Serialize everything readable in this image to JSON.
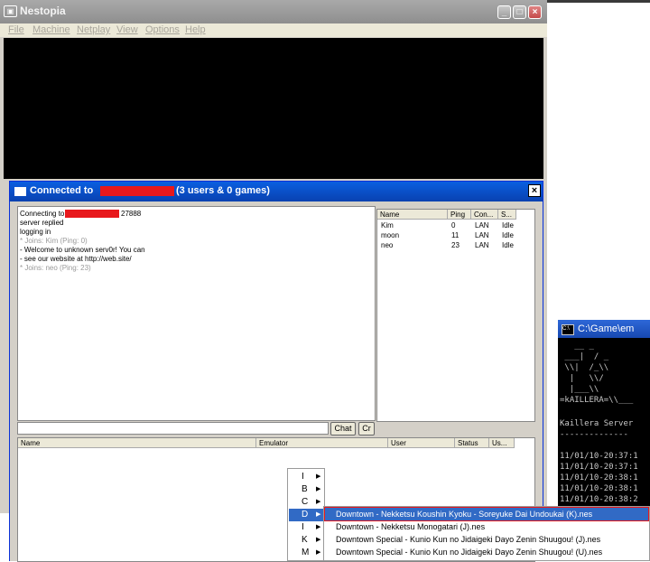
{
  "nestopia": {
    "title": "Nestopia",
    "menu": [
      "File",
      "Machine",
      "Netplay",
      "View",
      "Options",
      "Help"
    ]
  },
  "dialog": {
    "title_prefix": "Connected to",
    "title_suffix": "(3 users & 0 games)",
    "chat_lines": [
      {
        "text": "Connecting to",
        "style": "normal"
      },
      {
        "text": "27888",
        "style": "normal"
      },
      {
        "text": "server replied",
        "style": "normal"
      },
      {
        "text": "logging in",
        "style": "normal"
      },
      {
        "text": "* Joins: Kim (Ping: 0)",
        "style": "gray"
      },
      {
        "text": "- Welcome to unknown serv0r! You can",
        "style": "normal"
      },
      {
        "text": "- see our website at http://web.site/",
        "style": "normal"
      },
      {
        "text": "* Joins: neo (Ping: 23)",
        "style": "gray"
      }
    ],
    "user_columns": [
      "Name",
      "Ping",
      "Con...",
      "S..."
    ],
    "users": [
      {
        "name": "Kim",
        "ping": "0",
        "conn": "LAN",
        "status": "Idle"
      },
      {
        "name": "moon",
        "ping": "11",
        "conn": "LAN",
        "status": "Idle"
      },
      {
        "name": "neo",
        "ping": "23",
        "conn": "LAN",
        "status": "Idle"
      }
    ],
    "chat_button": "Chat",
    "create_button": "Cr",
    "game_columns": [
      "Name",
      "Emulator",
      "User",
      "Status",
      "Us..."
    ]
  },
  "context_menu": {
    "items": [
      "I",
      "B",
      "C",
      "D",
      "I",
      "K",
      "M"
    ],
    "selected_index": 3
  },
  "submenu": {
    "items": [
      "Downtown - Nekketsu Koushin Kyoku - Soreyuke Dai Undoukai (K).nes",
      "Downtown - Nekketsu Monogatari (J).nes",
      "Downtown Special - Kunio Kun no Jidaigeki Dayo Zenin Shuugou! (J).nes",
      "Downtown Special - Kunio Kun no Jidaigeki Dayo Zenin Shuugou! (U).nes"
    ],
    "selected_index": 0
  },
  "console": {
    "title": "C:\\Game\\em",
    "lines": [
      "   __ _",
      " ___|  / _",
      " \\\\|  /_\\\\",
      "  |   \\\\/",
      "  |___\\\\",
      "=kAILLERA=\\\\___",
      "",
      "Kaillera Server",
      "--------------",
      "",
      "11/01/10-20:37:1",
      "11/01/10-20:37:1",
      "11/01/10-20:38:1",
      "11/01/10-20:38:1",
      "11/01/10-20:38:2"
    ]
  }
}
